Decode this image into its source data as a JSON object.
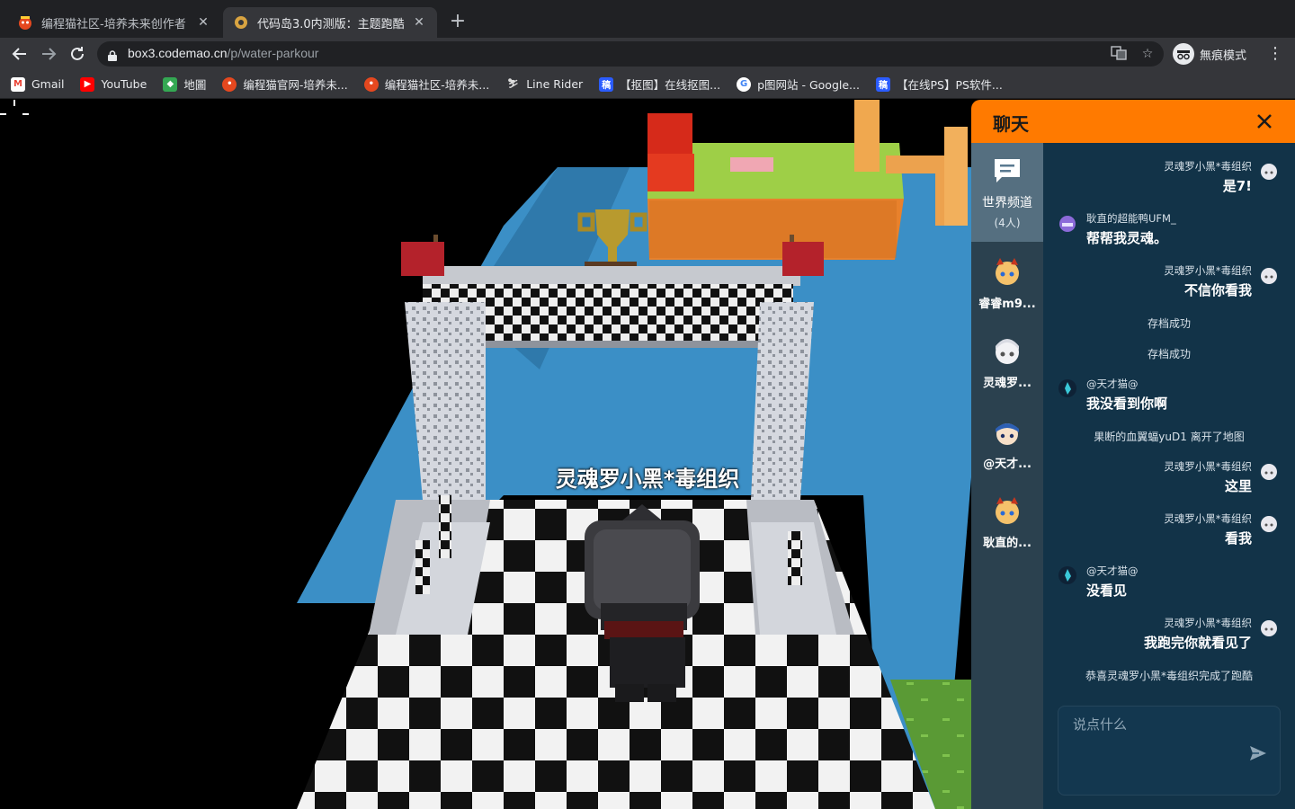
{
  "browser": {
    "tabs": [
      {
        "title": "编程猫社区-培养未来创作者",
        "active": false
      },
      {
        "title": "代码岛3.0内测版：主题跑酷",
        "active": true
      }
    ],
    "url_host": "box3.codemao.cn",
    "url_path": "/p/water-parkour",
    "incognito_label": "無痕模式",
    "bookmarks": [
      {
        "label": "Gmail",
        "icon": "gmail-icon",
        "color": "#ea4335"
      },
      {
        "label": "YouTube",
        "icon": "youtube-icon",
        "color": "#ff0000"
      },
      {
        "label": "地圖",
        "icon": "maps-icon",
        "color": "#34a853"
      },
      {
        "label": "编程猫官网-培养未...",
        "icon": "codemao-icon",
        "color": "#e5481f"
      },
      {
        "label": "编程猫社区-培养未...",
        "icon": "codemao-icon",
        "color": "#e5481f"
      },
      {
        "label": "Line Rider",
        "icon": "linerider-icon",
        "color": "#dddddd"
      },
      {
        "label": "【抠图】在线抠图...",
        "icon": "gaoding-icon",
        "color": "#2b5cff"
      },
      {
        "label": "p图网站 - Google...",
        "icon": "google-icon",
        "color": "#4285f4"
      },
      {
        "label": "【在线PS】PS软件...",
        "icon": "gaoding-icon",
        "color": "#2b5cff"
      }
    ]
  },
  "game": {
    "player_name": "灵魂罗小黑*毒组织"
  },
  "chat": {
    "title": "聊天",
    "channel": {
      "name": "世界频道",
      "count": "(4人)"
    },
    "users": [
      {
        "name": "睿睿m9...",
        "avatar": "cat-girl-avatar"
      },
      {
        "name": "灵魂罗...",
        "avatar": "white-hair-avatar"
      },
      {
        "name": "@天才...",
        "avatar": "blue-hair-avatar"
      },
      {
        "name": "耿直的...",
        "avatar": "cat-girl-avatar"
      }
    ],
    "messages": [
      {
        "type": "msg",
        "side": "right",
        "author": "灵魂罗小黑*毒组织",
        "text": "是7!"
      },
      {
        "type": "msg",
        "side": "left",
        "author": "耿直的超能鸭UFM_",
        "text": "帮帮我灵魂。"
      },
      {
        "type": "msg",
        "side": "right",
        "author": "灵魂罗小黑*毒组织",
        "text": "不信你看我"
      },
      {
        "type": "sys",
        "text": "存档成功"
      },
      {
        "type": "sys",
        "text": "存档成功"
      },
      {
        "type": "msg",
        "side": "left",
        "author": "@天才猫@",
        "text": "我没看到你啊"
      },
      {
        "type": "sys",
        "text": "果断的血翼蝠yuD1 离开了地图"
      },
      {
        "type": "msg",
        "side": "right",
        "author": "灵魂罗小黑*毒组织",
        "text": "这里"
      },
      {
        "type": "msg",
        "side": "right",
        "author": "灵魂罗小黑*毒组织",
        "text": "看我"
      },
      {
        "type": "msg",
        "side": "left",
        "author": "@天才猫@",
        "text": "没看见"
      },
      {
        "type": "msg",
        "side": "right",
        "author": "灵魂罗小黑*毒组织",
        "text": "我跑完你就看见了"
      },
      {
        "type": "sys",
        "text": "恭喜灵魂罗小黑*毒组织完成了跑酷"
      }
    ],
    "input_placeholder": "说点什么",
    "accent_color": "#ff7a00"
  }
}
